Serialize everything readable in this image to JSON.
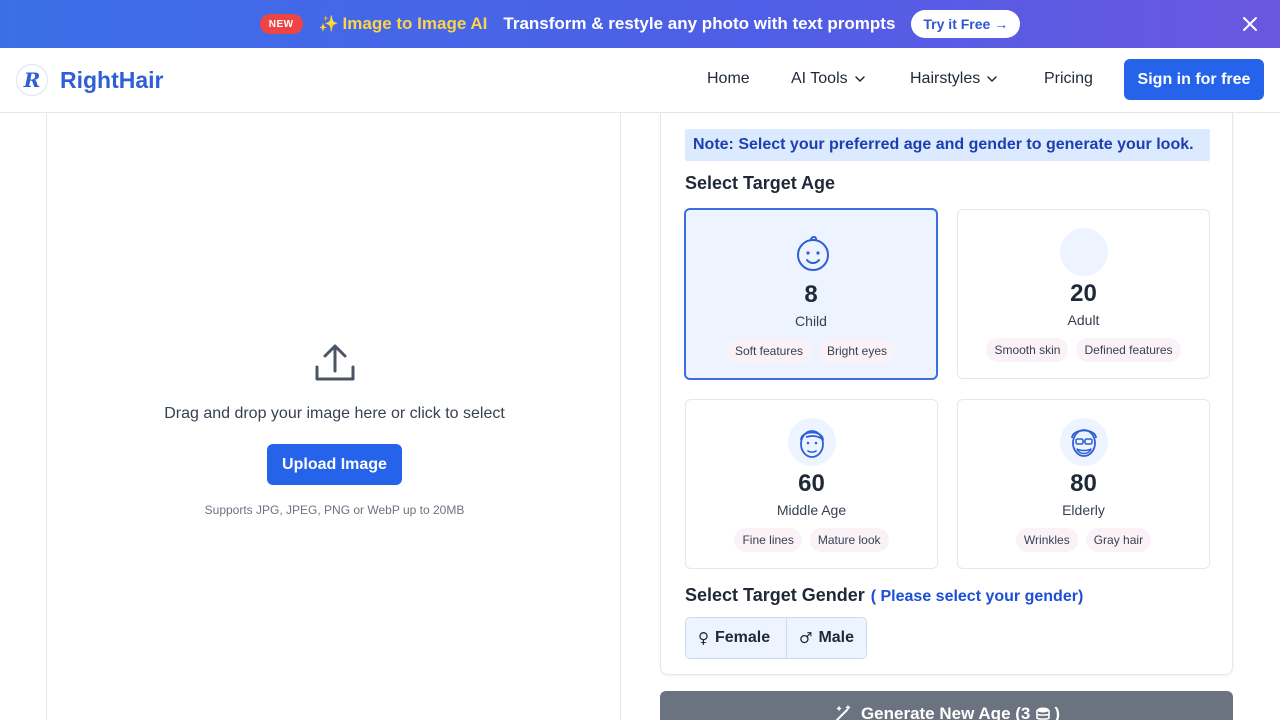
{
  "promo": {
    "badge": "NEW",
    "name": "Image to Image AI",
    "text": "Transform & restyle any photo with text prompts",
    "cta": "Try it Free →"
  },
  "header": {
    "logo_letter": "R",
    "brand": "RightHair",
    "nav": [
      {
        "label": "Home",
        "has_dropdown": false
      },
      {
        "label": "AI Tools",
        "has_dropdown": true
      },
      {
        "label": "Hairstyles",
        "has_dropdown": true
      },
      {
        "label": "Pricing",
        "has_dropdown": false
      }
    ],
    "signin": "Sign in for free"
  },
  "upload": {
    "prompt": "Drag and drop your image here or click to select",
    "button": "Upload Image",
    "hint": "Supports JPG, JPEG, PNG or WebP up to 20MB"
  },
  "settings": {
    "note": "Note: Select your preferred age and gender to generate your look.",
    "age_title": "Select Target Age",
    "ages": [
      {
        "age": "8",
        "label": "Child",
        "tags": [
          "Soft features",
          "Bright eyes"
        ],
        "selected": true
      },
      {
        "age": "20",
        "label": "Adult",
        "tags": [
          "Smooth skin",
          "Defined features"
        ],
        "selected": false
      },
      {
        "age": "60",
        "label": "Middle Age",
        "tags": [
          "Fine lines",
          "Mature look"
        ],
        "selected": false
      },
      {
        "age": "80",
        "label": "Elderly",
        "tags": [
          "Wrinkles",
          "Gray hair"
        ],
        "selected": false
      }
    ],
    "gender_title": "Select Target Gender",
    "gender_hint": "( Please select your gender)",
    "genders": [
      {
        "glyph": "♀",
        "label": "Female"
      },
      {
        "glyph": "♂",
        "label": "Male"
      }
    ]
  },
  "generate": {
    "label": "Generate New Age (3",
    "suffix": ")"
  },
  "colors": {
    "accent": "#2563eb",
    "brand": "#2f5fd6",
    "promo_highlight": "#fcd34d",
    "selected_card_bg": "#eef4ff"
  }
}
